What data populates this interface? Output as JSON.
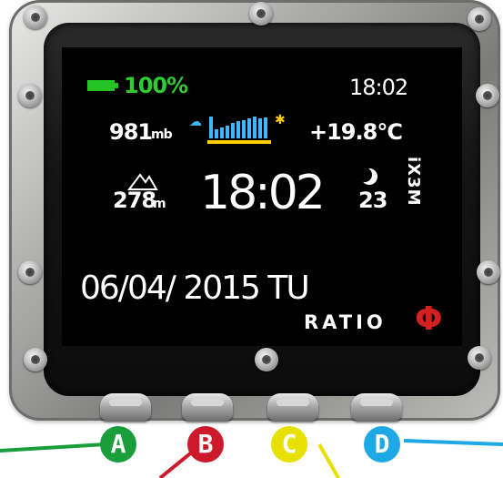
{
  "device": {
    "model_label": "iX3M",
    "brand_text": "RATIO",
    "brand_symbol": "Φ"
  },
  "screen": {
    "battery_percent_label": "100%",
    "battery_level_percent": 100,
    "clock_small": "18:02",
    "pressure_value": "981",
    "pressure_unit": "mb",
    "temperature": "+19.8°C",
    "altitude_value": "278",
    "altitude_unit": "m",
    "clock_large": "18:02",
    "moon_value": "23",
    "date": "06/04/ 2015 TU",
    "barometer_trend_bars": [
      1,
      0.4,
      0.5,
      0.6,
      0.7,
      0.8,
      0.85,
      0.9,
      1.0,
      0.9,
      0.95
    ]
  },
  "buttons": [
    {
      "letter": "A",
      "color": "#1a9e3c"
    },
    {
      "letter": "B",
      "color": "#cc1a2a"
    },
    {
      "letter": "C",
      "color": "#e8e000"
    },
    {
      "letter": "D",
      "color": "#1fa8e6"
    }
  ],
  "colors": {
    "accent_green": "#2ecc2e",
    "barometer_blue": "#3fb7ff",
    "barometer_yellow": "#ffd000",
    "logo_red": "#d32020"
  }
}
